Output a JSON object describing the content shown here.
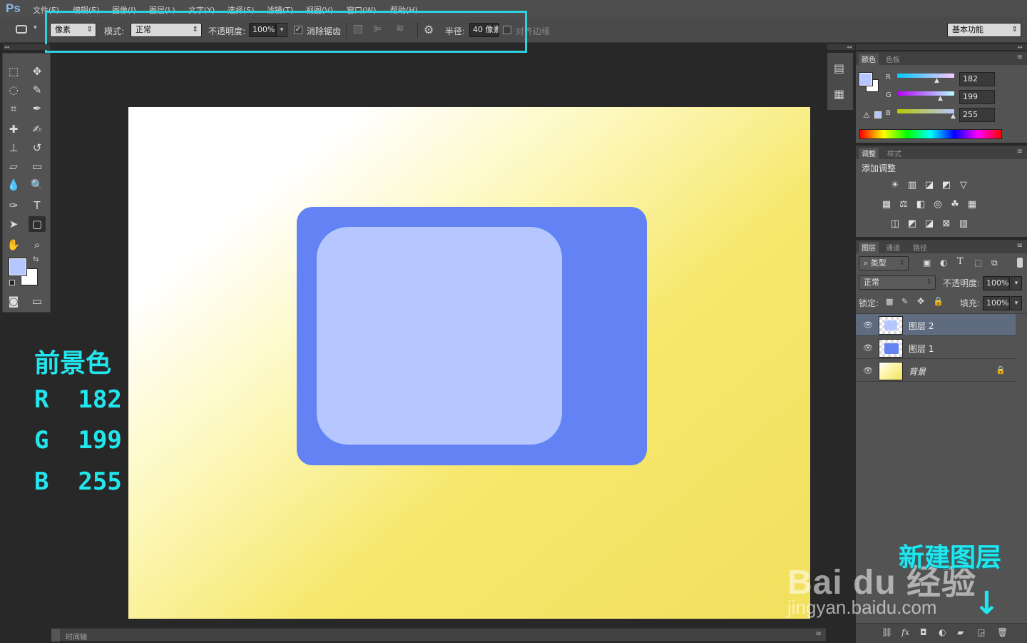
{
  "app": {
    "logo": "Ps"
  },
  "menu": [
    "文件(F)",
    "编辑(E)",
    "图像(I)",
    "图层(L)",
    "文字(Y)",
    "选择(S)",
    "滤镜(T)",
    "视图(V)",
    "窗口(W)",
    "帮助(H)"
  ],
  "options": {
    "tool_mode": "像素",
    "mode_label": "模式:",
    "mode_value": "正常",
    "opacity_label": "不透明度:",
    "opacity_value": "100%",
    "antialias_label": "消除锯齿",
    "radius_label": "半径:",
    "radius_value": "40 像素",
    "align_edges_label": "对齐边缘",
    "workspace": "基本功能"
  },
  "color_panel": {
    "tabs": [
      "颜色",
      "色板"
    ],
    "r_label": "R",
    "g_label": "G",
    "b_label": "B",
    "r": "182",
    "g": "199",
    "b": "255",
    "foreground_color": "#b6c7ff"
  },
  "adjust_panel": {
    "tabs": [
      "调整",
      "样式"
    ],
    "title": "添加调整"
  },
  "layers_panel": {
    "tabs": [
      "图层",
      "通道",
      "路径"
    ],
    "filter": "类型",
    "blend": "正常",
    "opacity_label": "不透明度:",
    "opacity_value": "100%",
    "lock_label": "锁定:",
    "fill_label": "填充:",
    "fill_value": "100%",
    "layers": [
      {
        "name": "图层 2",
        "selected": true
      },
      {
        "name": "图层 1",
        "selected": false
      },
      {
        "name": "背景",
        "selected": false
      }
    ]
  },
  "timeline": {
    "label": "时间轴"
  },
  "annotation": {
    "title": "前景色",
    "r": "R  182",
    "g": "G  199",
    "b": "B  255",
    "new_layer": "新建图层"
  },
  "watermark": {
    "logo": "Bai  du 经验",
    "url": "jingyan.baidu.com"
  },
  "colors": {
    "shape_dark": "#6383f4",
    "shape_light": "#b6c7ff",
    "accent": "#22e6ee"
  }
}
